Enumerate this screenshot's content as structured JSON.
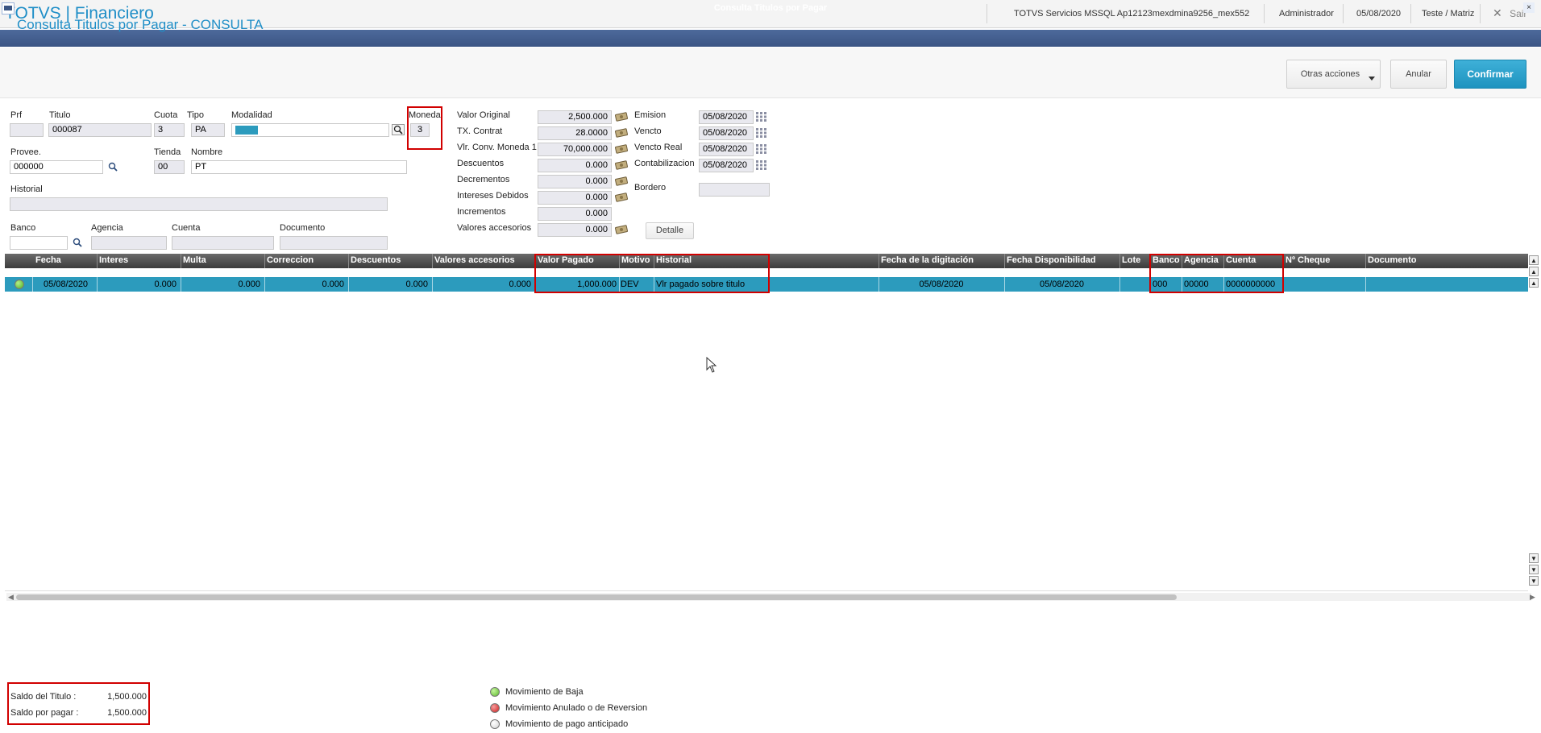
{
  "app": {
    "title": "TOTVS | Financiero",
    "server": "TOTVS Servicios MSSQL Ap12123mexdmina9256_mex552",
    "user": "Administrador",
    "date": "05/08/2020",
    "branch": "Teste / Matriz",
    "exit_label": "Sair"
  },
  "window": {
    "title": "Consulta Titulos por Pagar",
    "close_glyph": "×"
  },
  "header": {
    "page_title": "Consulta Titulos por Pagar - CONSULTA",
    "actions_label": "Otras acciones",
    "cancel_label": "Anular",
    "confirm_label": "Confirmar"
  },
  "form": {
    "prf_label": "Prf",
    "prf_value": "",
    "titulo_label": "Titulo",
    "titulo_value": "000087",
    "cuota_label": "Cuota",
    "cuota_value": "3",
    "tipo_label": "Tipo",
    "tipo_value": "PA",
    "modalidad_label": "Modalidad",
    "moneda_label": "Moneda",
    "moneda_value": "3",
    "provee_label": "Provee.",
    "provee_value": "000000",
    "tienda_label": "Tienda",
    "tienda_value": "00",
    "nombre_label": "Nombre",
    "nombre_value": "PT",
    "historial_label": "Historial",
    "historial_value": "",
    "banco_label": "Banco",
    "banco_value": "",
    "agencia_label": "Agencia",
    "agencia_value": "",
    "cuenta_label": "Cuenta",
    "cuenta_value": "",
    "documento_label": "Documento",
    "documento_value": "",
    "valor_original_label": "Valor Original",
    "valor_original_value": "2,500.000",
    "tx_contrat_label": "TX. Contrat",
    "tx_contrat_value": "28.0000",
    "vlr_conv_label": "Vlr. Conv. Moneda 1",
    "vlr_conv_value": "70,000.000",
    "descuentos_label": "Descuentos",
    "descuentos_value": "0.000",
    "decrementos_label": "Decrementos",
    "decrementos_value": "0.000",
    "intereses_label": "Intereses Debidos",
    "intereses_value": "0.000",
    "incrementos_label": "Incrementos",
    "incrementos_value": "0.000",
    "valores_acc_label": "Valores accesorios",
    "valores_acc_value": "0.000",
    "emision_label": "Emision",
    "emision_value": "05/08/2020",
    "vencto_label": "Vencto",
    "vencto_value": "05/08/2020",
    "vencto_real_label": "Vencto Real",
    "vencto_real_value": "05/08/2020",
    "contab_label": "Contabilizacion",
    "contab_value": "05/08/2020",
    "bordero_label": "Bordero",
    "bordero_value": "",
    "detalle_label": "Detalle"
  },
  "grid": {
    "columns": [
      "Fecha",
      "Interes",
      "Multa",
      "Correccion",
      "Descuentos",
      "Valores accesorios",
      "Valor Pagado",
      "Motivo",
      "Historial",
      "Fecha de la digitación",
      "Fecha Disponibilidad",
      "Lote",
      "Banco",
      "Agencia",
      "Cuenta",
      "Nº Cheque",
      "Documento"
    ],
    "rows": [
      {
        "status": "Movimiento de Baja",
        "fecha": "05/08/2020",
        "interes": "0.000",
        "multa": "0.000",
        "correccion": "0.000",
        "descuentos": "0.000",
        "valores_accesorios": "0.000",
        "valor_pagado": "1,000.000",
        "motivo": "DEV",
        "historial": "Vlr pagado sobre titulo",
        "fecha_digitacion": "05/08/2020",
        "fecha_disponibilidad": "05/08/2020",
        "lote": "",
        "banco": "000",
        "agencia": "00000",
        "cuenta": "0000000000",
        "cheque": "",
        "documento": ""
      }
    ]
  },
  "footer": {
    "saldo_titulo_label": "Saldo del Titulo :",
    "saldo_titulo_value": "1,500.000",
    "saldo_pagar_label": "Saldo por pagar  :",
    "saldo_pagar_value": "1,500.000",
    "legend": [
      {
        "label": "Movimiento de Baja",
        "color": "#66bb33"
      },
      {
        "label": "Movimiento Anulado o de Reversion",
        "color": "#d02020"
      },
      {
        "label": "Movimiento de pago anticipado",
        "color": "#e0e0e0"
      }
    ]
  },
  "colors": {
    "accent": "#1f8ec7",
    "selection": "#2c9bbd",
    "highlight_box": "#d10000"
  }
}
